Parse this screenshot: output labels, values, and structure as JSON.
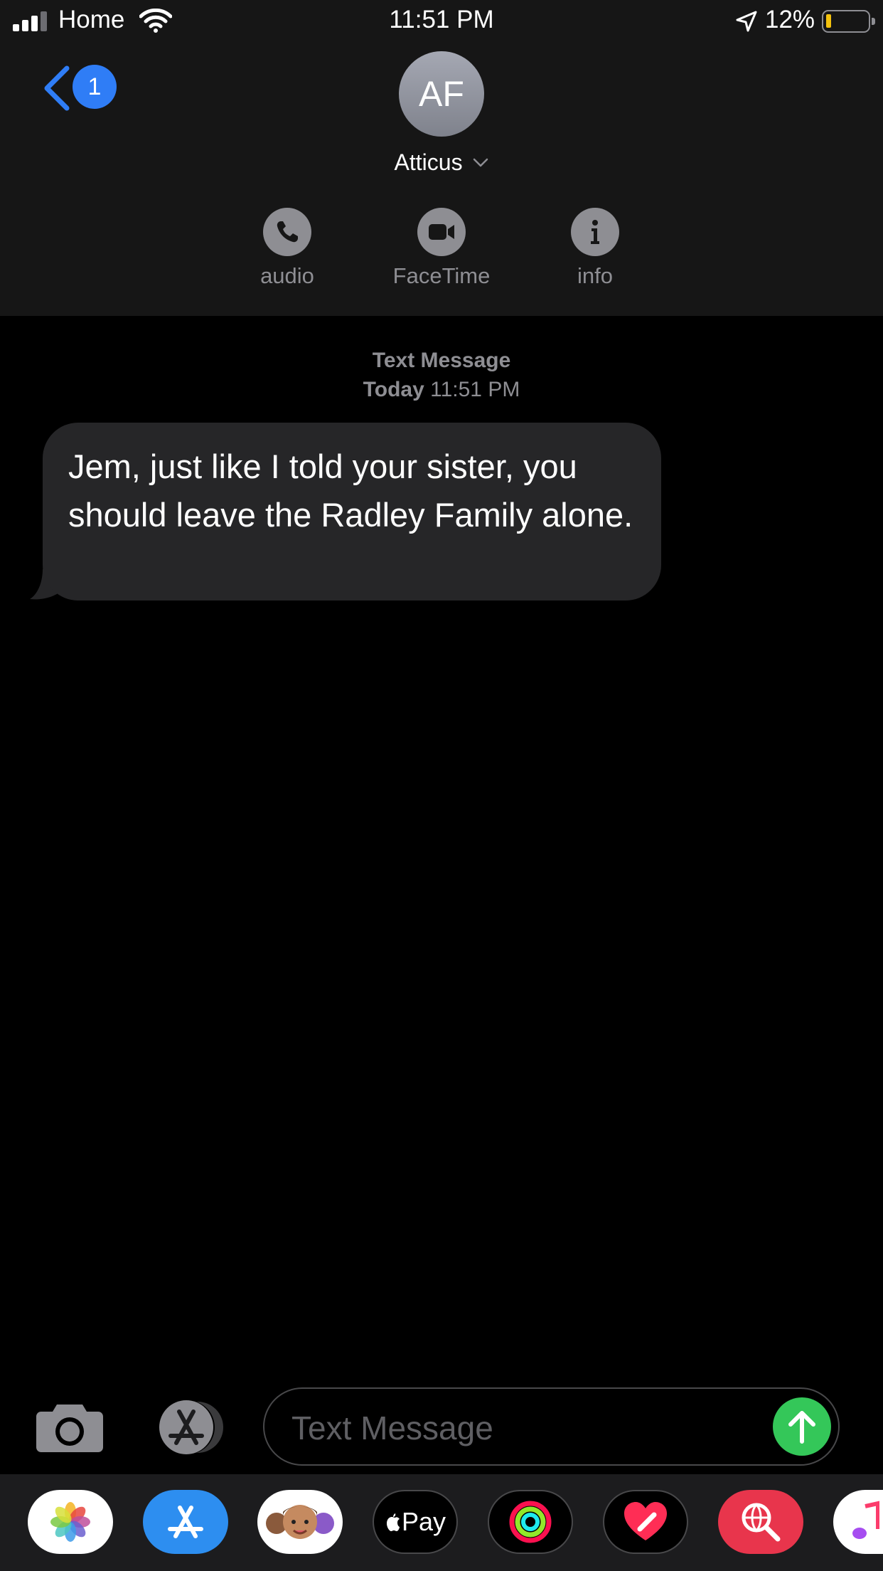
{
  "status_bar": {
    "carrier": "Home",
    "time": "11:51 PM",
    "battery_percent": "12%",
    "battery_level": 0.12,
    "icons": [
      "signal-icon",
      "wifi-icon",
      "location-arrow-icon",
      "battery-icon"
    ]
  },
  "nav": {
    "back_badge": "1",
    "back_icon": "chevron-left-icon"
  },
  "contact": {
    "initials": "AF",
    "name": "Atticus"
  },
  "actions": [
    {
      "label": "audio",
      "icon": "phone-icon"
    },
    {
      "label": "FaceTime",
      "icon": "video-camera-icon"
    },
    {
      "label": "info",
      "icon": "info-icon"
    }
  ],
  "conversation": {
    "service": "Text Message",
    "day": "Today",
    "time": "11:51 PM",
    "messages": [
      {
        "text": "Jem, just like I told your sister, you should leave the Radley Family alone."
      }
    ]
  },
  "composer": {
    "placeholder": "Text Message",
    "icons": [
      "camera-icon",
      "app-store-icon",
      "send-arrow-icon"
    ]
  },
  "app_drawer": {
    "apps": [
      "Photos",
      "App Store",
      "Memoji",
      "Apple Pay",
      "Activity",
      "Digital Touch",
      "Web Search",
      "Music"
    ],
    "pay_label": "Pay"
  },
  "colors": {
    "accent_blue": "#2f7df6",
    "send_green": "#34c759",
    "bubble_gray": "#262628",
    "header_bg": "#161616",
    "battery_low": "#f4c20d"
  }
}
